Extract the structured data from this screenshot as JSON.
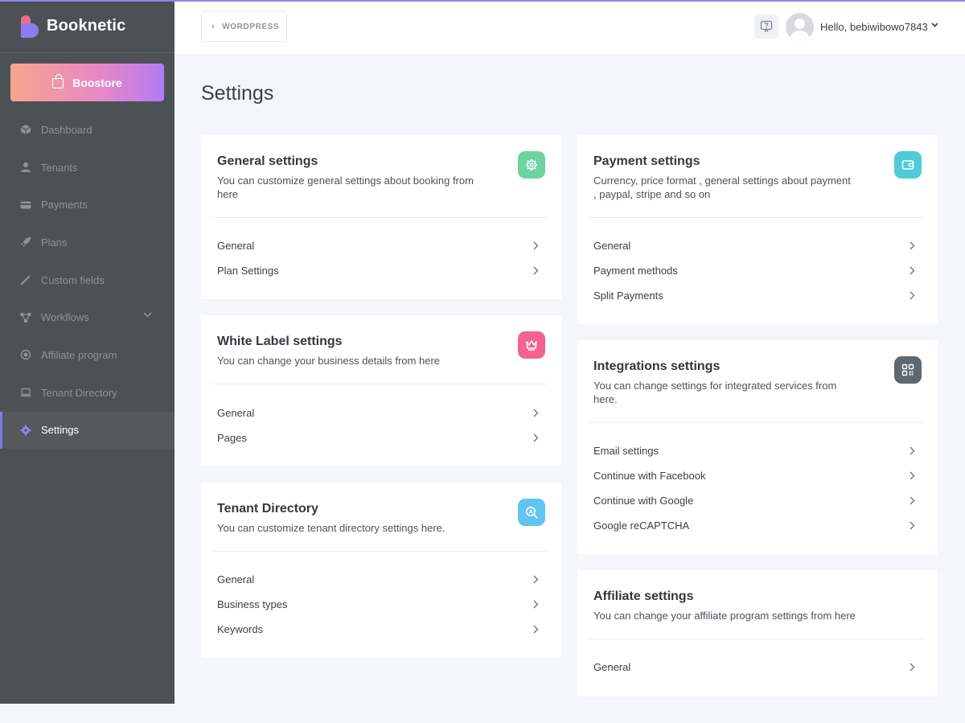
{
  "app": {
    "brand": "Booknetic"
  },
  "sidebar": {
    "boostore_label": "Boostore",
    "items": [
      {
        "label": "Dashboard",
        "icon": "cube-icon"
      },
      {
        "label": "Tenants",
        "icon": "user-icon"
      },
      {
        "label": "Payments",
        "icon": "credit-card-icon"
      },
      {
        "label": "Plans",
        "icon": "rocket-icon"
      },
      {
        "label": "Custom fields",
        "icon": "magic-wand-icon"
      },
      {
        "label": "Workflows",
        "icon": "workflow-icon"
      },
      {
        "label": "Affiliate program",
        "icon": "target-icon"
      },
      {
        "label": "Tenant Directory",
        "icon": "laptop-icon"
      },
      {
        "label": "Settings",
        "icon": "gear-icon",
        "active": true
      }
    ]
  },
  "header": {
    "back_label": "WORDPRESS",
    "greeting": "Hello, bebiwibowo7843"
  },
  "page": {
    "title": "Settings"
  },
  "cards": {
    "general": {
      "title": "General settings",
      "desc": "You can customize general settings about booking from here",
      "icon_color": "#6fd3a0",
      "links": [
        "General",
        "Plan Settings"
      ]
    },
    "white_label": {
      "title": "White Label settings",
      "desc": "You can change your business details from here",
      "icon_color": "#f4638f",
      "links": [
        "General",
        "Pages"
      ]
    },
    "tenant_directory": {
      "title": "Tenant Directory",
      "desc": "You can customize tenant directory settings here.",
      "icon_color": "#60c5f1",
      "links": [
        "General",
        "Business types",
        "Keywords"
      ]
    },
    "payment": {
      "title": "Payment settings",
      "desc": "Currency, price format , general settings about payment , paypal, stripe and so on",
      "icon_color": "#4fcbd7",
      "links": [
        "General",
        "Payment methods",
        "Split Payments"
      ]
    },
    "integrations": {
      "title": "Integrations settings",
      "desc": "You can change settings for integrated services from here.",
      "icon_color": "#5f676f",
      "links": [
        "Email settings",
        "Continue with Facebook",
        "Continue with Google",
        "Google reCAPTCHA"
      ]
    },
    "affiliate": {
      "title": "Affiliate settings",
      "desc": "You can change your affiliate program settings from here",
      "links": [
        "General"
      ]
    }
  }
}
